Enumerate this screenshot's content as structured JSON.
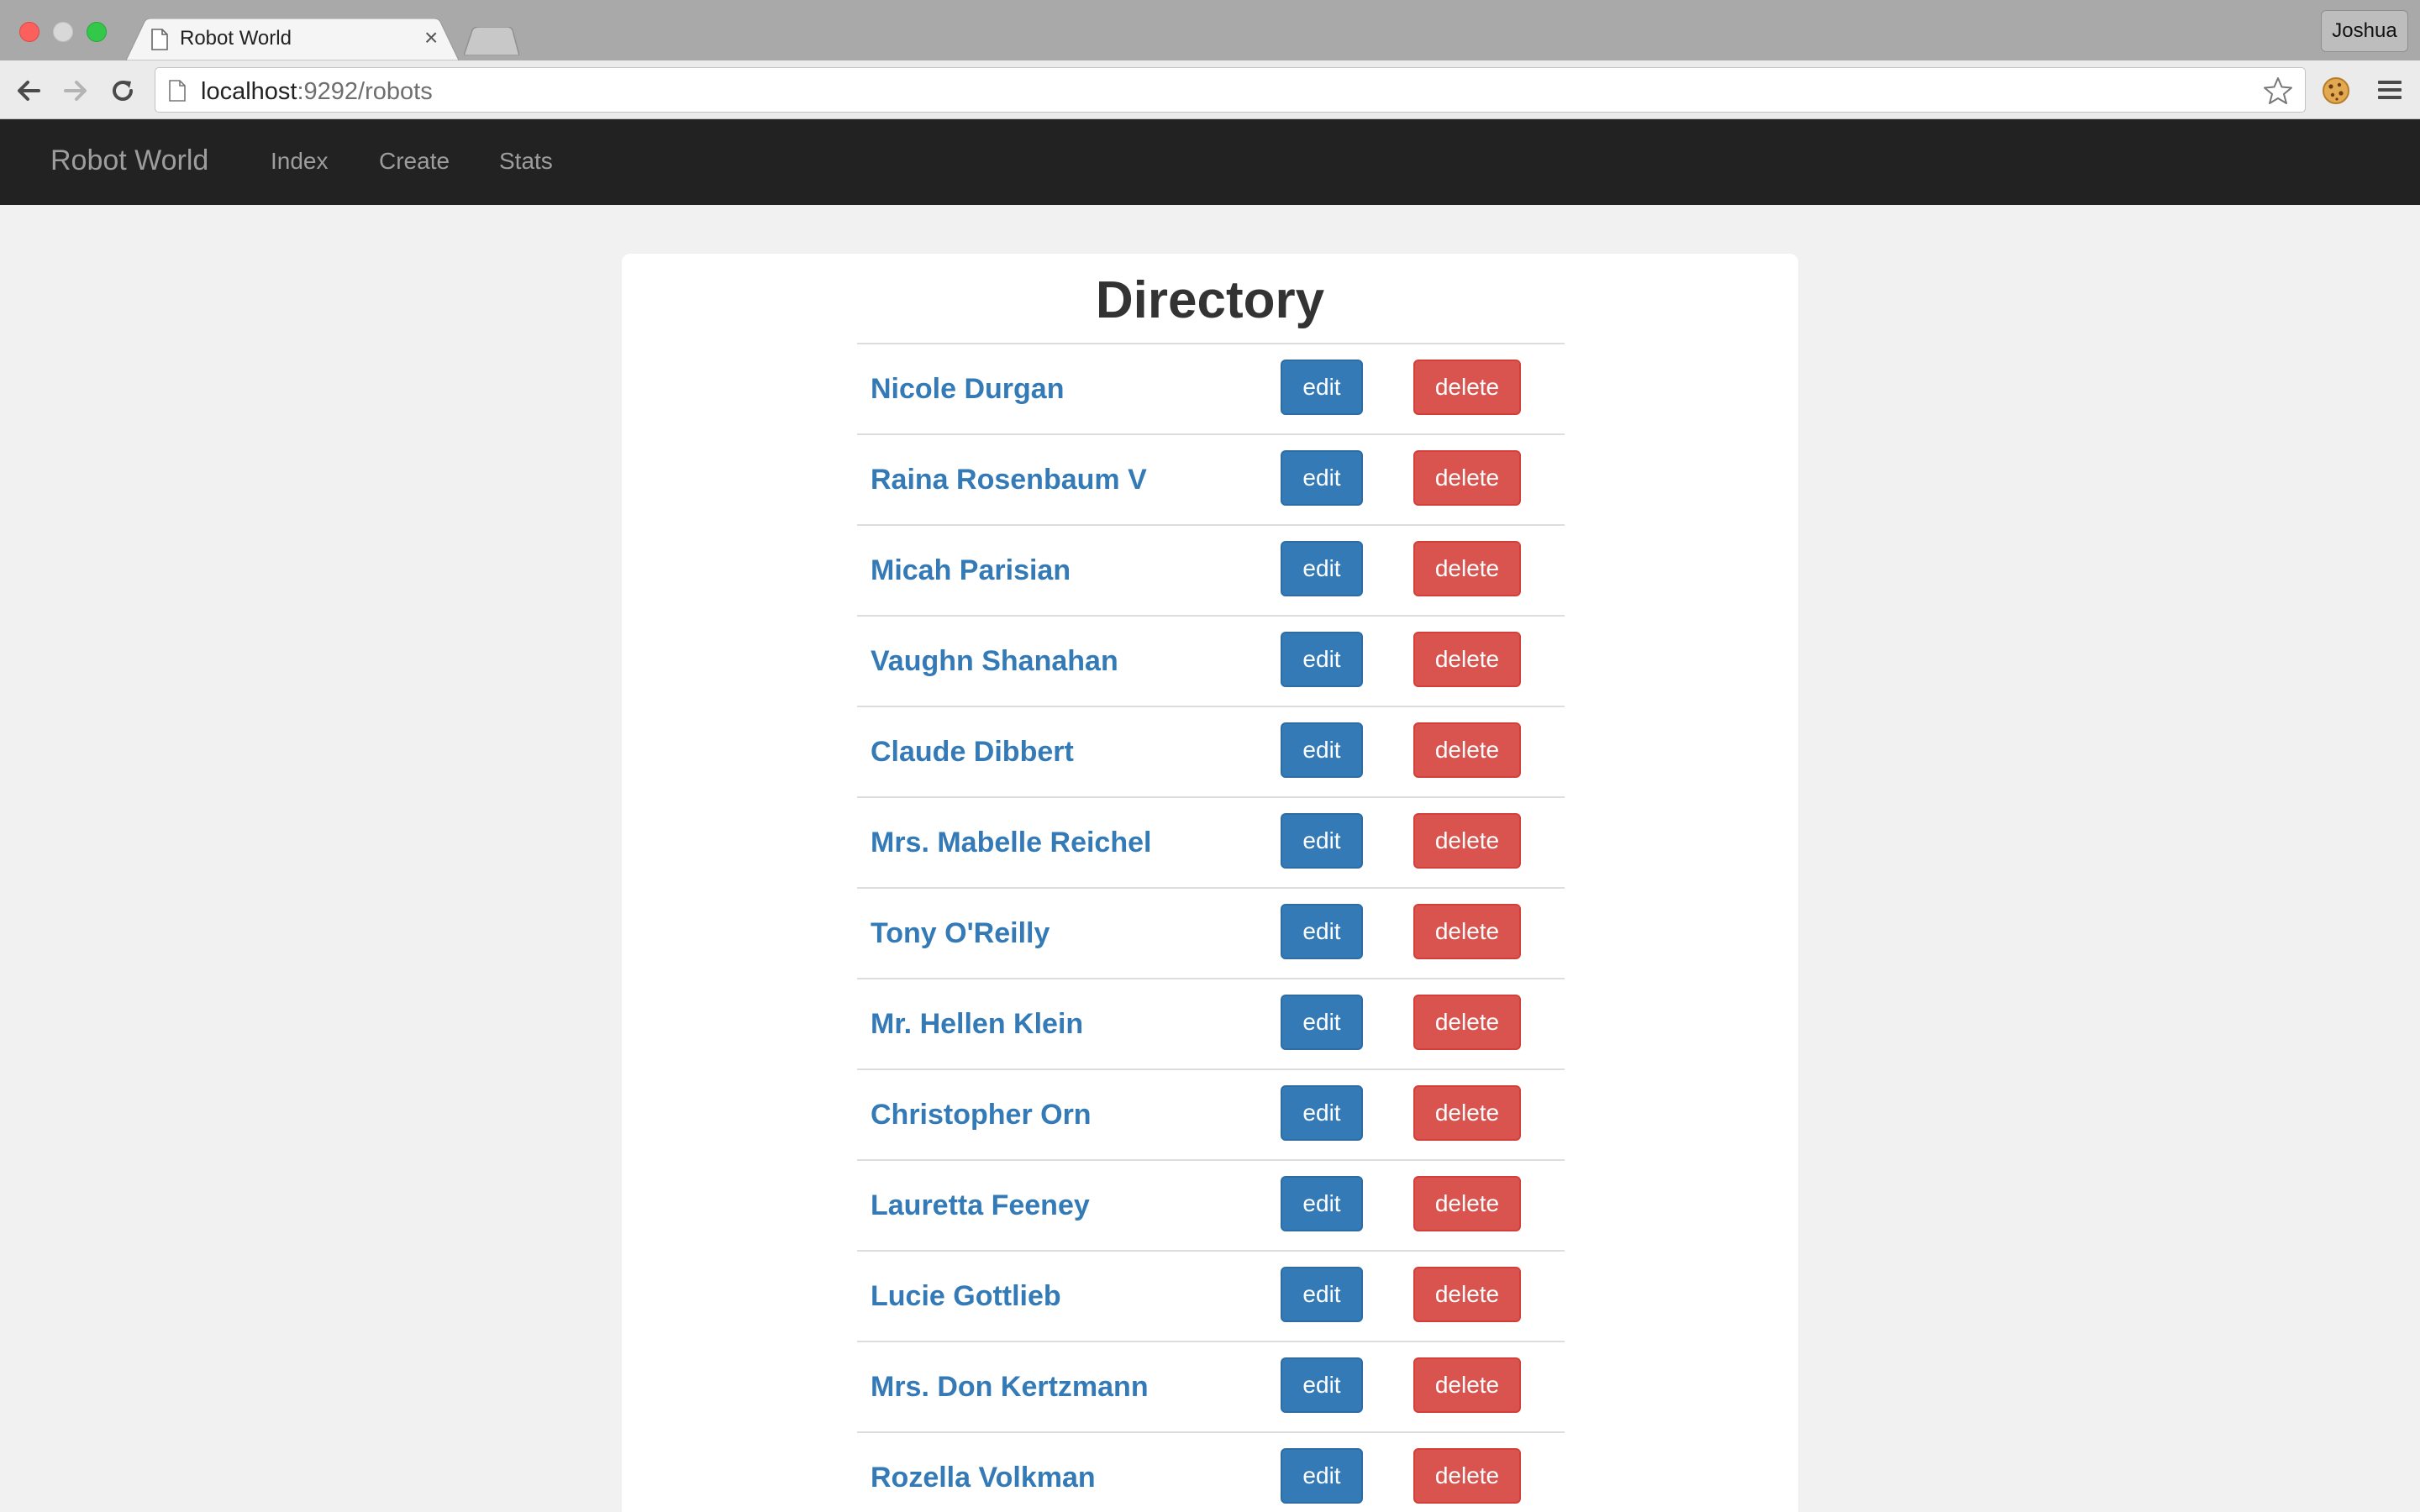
{
  "browser": {
    "tab_title": "Robot World",
    "profile_name": "Joshua",
    "url_host": "localhost",
    "url_rest": ":9292/robots"
  },
  "icons": {
    "back": "back-arrow-icon",
    "forward": "forward-arrow-icon",
    "reload": "reload-icon",
    "page": "document-icon",
    "bookmark": "star-icon",
    "extension": "cookie-icon",
    "menu": "hamburger-menu-icon"
  },
  "navbar": {
    "brand": "Robot World",
    "links": [
      "Index",
      "Create",
      "Stats"
    ]
  },
  "main": {
    "title": "Directory",
    "edit_label": "edit",
    "delete_label": "delete",
    "robots": [
      "Nicole Durgan",
      "Raina Rosenbaum V",
      "Micah Parisian",
      "Vaughn Shanahan",
      "Claude Dibbert",
      "Mrs. Mabelle Reichel",
      "Tony O'Reilly",
      "Mr. Hellen Klein",
      "Christopher Orn",
      "Lauretta Feeney",
      "Lucie Gottlieb",
      "Mrs. Don Kertzmann",
      "Rozella Volkman"
    ]
  },
  "colors": {
    "navbar_bg": "#222222",
    "link_blue": "#337ab7",
    "edit_button": "#337ab7",
    "delete_button": "#d9534f",
    "page_bg": "#f1f1f1"
  }
}
